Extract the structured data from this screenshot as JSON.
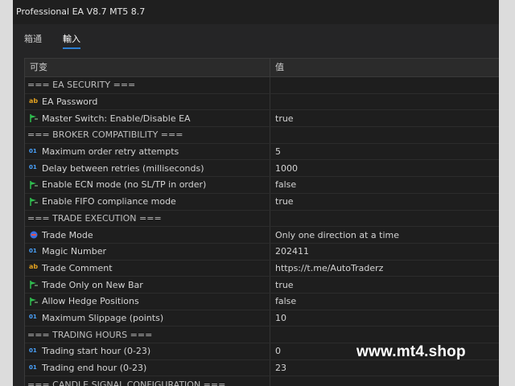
{
  "window": {
    "title": "Professional EA V8.7 MT5 8.7"
  },
  "tabs": [
    {
      "label": "箱通"
    },
    {
      "label": "輸入"
    }
  ],
  "grid": {
    "col_name": "可变",
    "col_value": "值",
    "rows": [
      {
        "type": "header",
        "name": "=== EA SECURITY ===",
        "value": ""
      },
      {
        "type": "str",
        "icon": "string-type-icon",
        "name": "EA Password",
        "value": ""
      },
      {
        "type": "bool",
        "icon": "bool-type-icon",
        "name": "Master Switch: Enable/Disable EA",
        "value": "true"
      },
      {
        "type": "header",
        "name": "=== BROKER COMPATIBILITY ===",
        "value": ""
      },
      {
        "type": "int",
        "icon": "integer-type-icon",
        "name": "Maximum order retry attempts",
        "value": "5"
      },
      {
        "type": "int",
        "icon": "integer-type-icon",
        "name": "Delay between retries (milliseconds)",
        "value": "1000"
      },
      {
        "type": "bool",
        "icon": "bool-type-icon",
        "name": "Enable ECN mode (no SL/TP in order)",
        "value": "false"
      },
      {
        "type": "bool",
        "icon": "bool-type-icon",
        "name": "Enable FIFO compliance mode",
        "value": "true"
      },
      {
        "type": "header",
        "name": "=== TRADE EXECUTION ===",
        "value": ""
      },
      {
        "type": "enum",
        "icon": "enum-type-icon",
        "name": "Trade Mode",
        "value": "Only one direction at a time"
      },
      {
        "type": "int",
        "icon": "integer-type-icon",
        "name": "Magic Number",
        "value": "202411"
      },
      {
        "type": "str",
        "icon": "string-type-icon",
        "name": "Trade Comment",
        "value": "https://t.me/AutoTraderz"
      },
      {
        "type": "bool",
        "icon": "bool-type-icon",
        "name": "Trade Only on New Bar",
        "value": "true"
      },
      {
        "type": "bool",
        "icon": "bool-type-icon",
        "name": "Allow Hedge Positions",
        "value": "false"
      },
      {
        "type": "int",
        "icon": "integer-type-icon",
        "name": "Maximum Slippage (points)",
        "value": "10"
      },
      {
        "type": "header",
        "name": "=== TRADING HOURS ===",
        "value": ""
      },
      {
        "type": "int",
        "icon": "integer-type-icon",
        "name": "Trading start hour (0-23)",
        "value": "0"
      },
      {
        "type": "int",
        "icon": "integer-type-icon",
        "name": "Trading end hour (0-23)",
        "value": "23"
      },
      {
        "type": "header",
        "name": "=== CANDLE SIGNAL CONFIGURATION ===",
        "value": ""
      }
    ]
  },
  "watermark": {
    "text": "www.mt4.shop"
  },
  "colors": {
    "accent": "#2d7fd3",
    "background": "#1e1e1e",
    "int_icon": "#4aa3ff",
    "string_icon": "#e0a020",
    "bool_icon": "#2fbf4f",
    "enum_icon": "#3a6fe0"
  }
}
